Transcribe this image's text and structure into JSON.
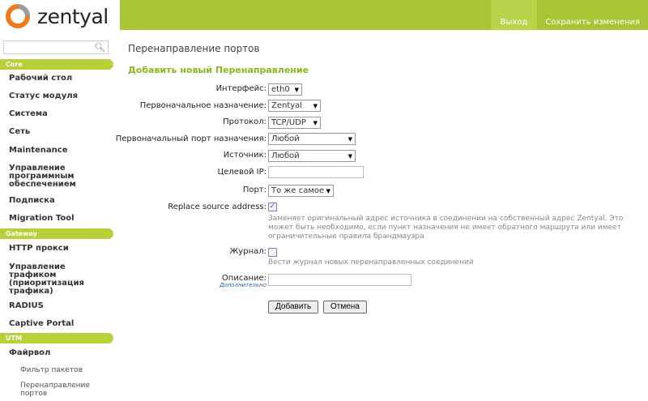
{
  "brand": {
    "name": "zentyal",
    "accent": "#a9c535"
  },
  "topnav": {
    "logout": "Выход",
    "save": "Сохранить изменения"
  },
  "sidebar": {
    "search_placeholder": "",
    "categories": [
      "Core",
      "Gateway",
      "UTM"
    ],
    "items": [
      "Рабочий стол",
      "Статус модуля",
      "Система",
      "Сеть",
      "Maintenance",
      "Управление программным обеспечением",
      "Подписка",
      "Migration Tool",
      "HTTP прокси",
      "Управление трафиком (приоритизация трафика)",
      "RADIUS",
      "Captive Portal",
      "Файрвол"
    ],
    "subitems": [
      "Фильтр пакетов",
      "Перенаправление портов"
    ]
  },
  "page": {
    "title": "Перенаправление портов",
    "section": "Добавить новый Перенаправление"
  },
  "form": {
    "interface": {
      "label": "Интерфейс:",
      "value": "eth0"
    },
    "orig_dest": {
      "label": "Первоначальное назначение:",
      "value": "Zentyal"
    },
    "protocol": {
      "label": "Протокол:",
      "value": "TCP/UDP"
    },
    "orig_port": {
      "label": "Первоначальный порт назначения:",
      "value": "Любой"
    },
    "source": {
      "label": "Источник:",
      "value": "Любой"
    },
    "target_ip": {
      "label": "Целевой IP:",
      "value": ""
    },
    "port": {
      "label": "Порт:",
      "value": "То же самое"
    },
    "replace_src": {
      "label": "Replace source address:",
      "checked": true,
      "help": "Заменяет оригинальный адрес источника в соединении на собственный адрес Zentyal. Это может быть необходимо, если пункт назначения не имеет обратного маршрута или имеет ограничительные правила брандмауэра"
    },
    "log": {
      "label": "Журнал:",
      "checked": false,
      "help": "Вести журнал новых перенаправленных соединений"
    },
    "description": {
      "label": "Описание:",
      "optional": "Дополнительно",
      "value": ""
    },
    "add": "Добавить",
    "cancel": "Отмена"
  }
}
